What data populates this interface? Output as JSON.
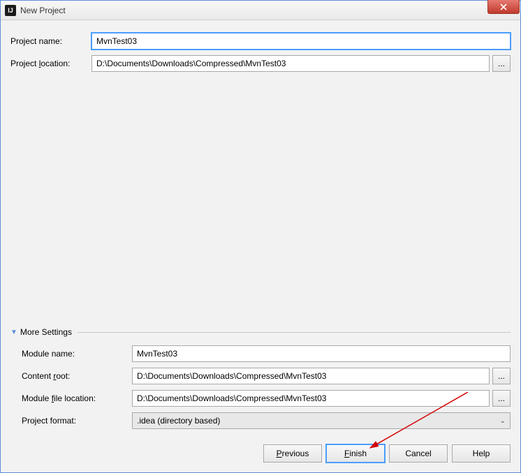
{
  "window": {
    "title": "New Project",
    "app_icon_text": "IJ"
  },
  "top_form": {
    "name_label": "Project name:",
    "name_value": "MvnTest03",
    "location_label_pre": "Project ",
    "location_label_u": "l",
    "location_label_post": "ocation:",
    "location_value": "D:\\Documents\\Downloads\\Compressed\\MvnTest03",
    "browse_label": "..."
  },
  "more": {
    "header": "More Settings",
    "module_name_label": "Module name:",
    "module_name_value": "MvnTest03",
    "content_root_label_pre": "Content ",
    "content_root_label_u": "r",
    "content_root_label_post": "oot:",
    "content_root_value": "D:\\Documents\\Downloads\\Compressed\\MvnTest03",
    "module_file_label_pre": "Module ",
    "module_file_label_u": "f",
    "module_file_label_post": "ile location:",
    "module_file_value": "D:\\Documents\\Downloads\\Compressed\\MvnTest03",
    "project_format_label": "Project format:",
    "project_format_value": ".idea (directory based)",
    "browse_label": "..."
  },
  "buttons": {
    "previous": "Previous",
    "finish": "Finish",
    "cancel": "Cancel",
    "help": "Help"
  }
}
